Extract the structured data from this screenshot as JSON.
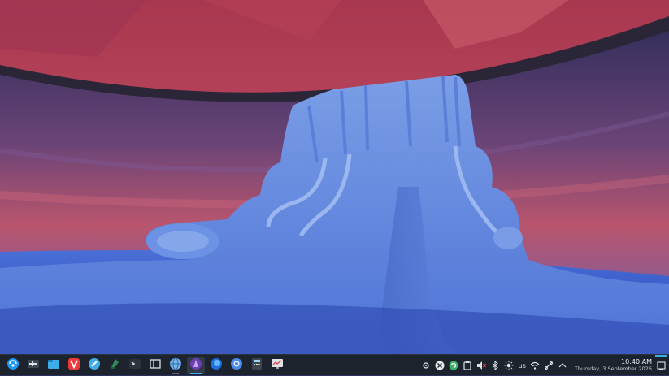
{
  "desktop": {
    "wallpaper": "plasma-waves",
    "colors": {
      "sky_top": "#b53c5a",
      "sky_mid": "#6a3f7c",
      "floor": "#3d6fd8",
      "ribbon": "#6f98e4"
    }
  },
  "taskbar": {
    "launcher_icon": "kde-logo-icon",
    "tasks": [
      {
        "name": "system-settings-icon",
        "state": "normal"
      },
      {
        "name": "dolphin-file-manager-icon",
        "state": "normal"
      },
      {
        "name": "vivaldi-browser-icon",
        "state": "normal"
      },
      {
        "name": "discover-store-icon",
        "state": "normal"
      },
      {
        "name": "kate-editor-icon",
        "state": "normal"
      },
      {
        "name": "konsole-terminal-icon",
        "state": "normal"
      },
      {
        "name": "window-panel-icon",
        "state": "normal"
      },
      {
        "name": "globe-browser-icon",
        "state": "running"
      },
      {
        "name": "purple-app-icon",
        "state": "active"
      },
      {
        "name": "firefox-icon",
        "state": "normal"
      },
      {
        "name": "chromium-icon",
        "state": "normal"
      },
      {
        "name": "calculator-icon",
        "state": "normal"
      },
      {
        "name": "system-monitor-icon",
        "state": "normal"
      }
    ],
    "tray": {
      "keyboard_layout": "us",
      "time": "10:40 AM",
      "date": "Thursday, 3 September 2026"
    }
  }
}
